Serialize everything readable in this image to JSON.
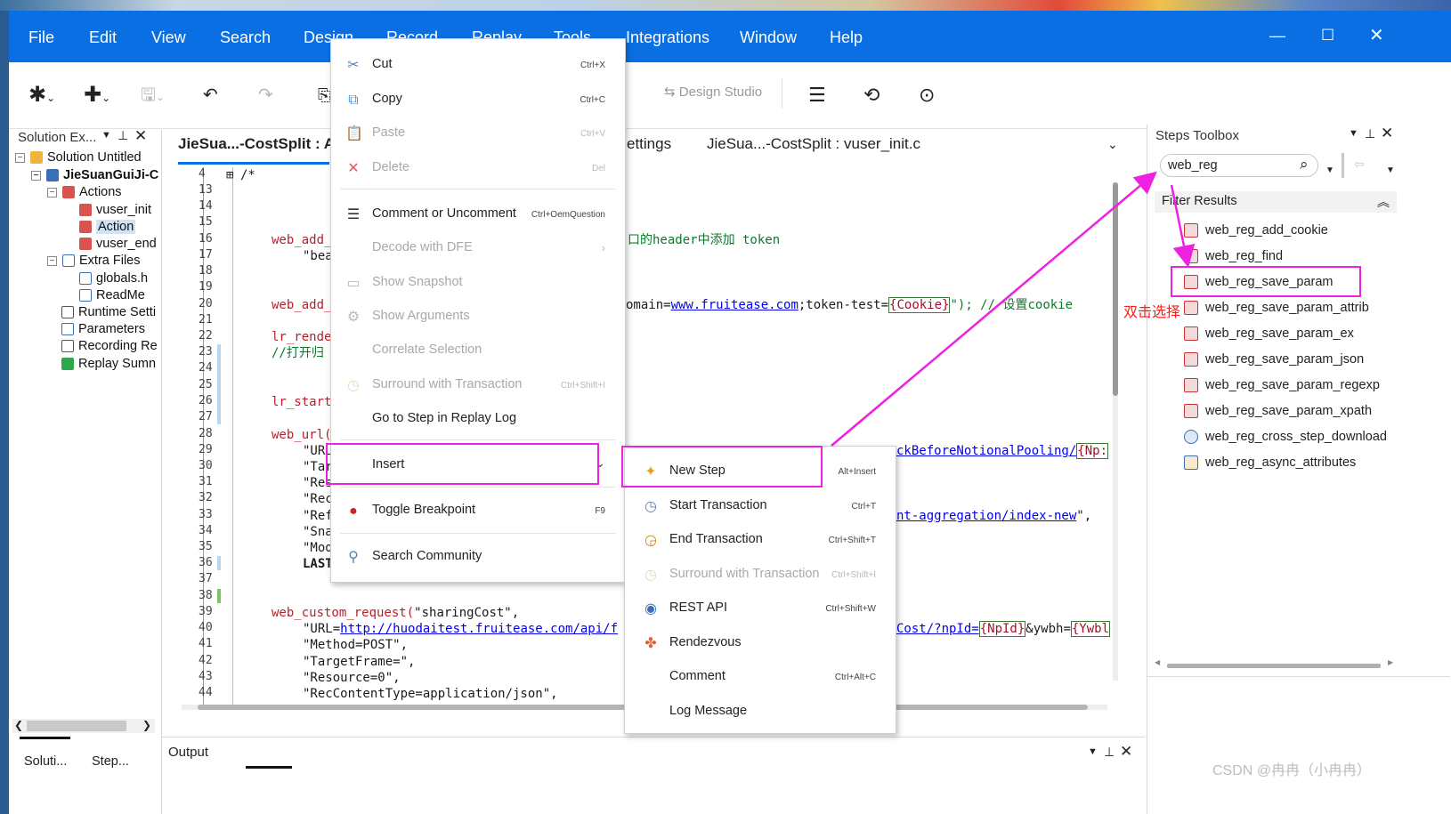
{
  "menubar": {
    "items": [
      "File",
      "Edit",
      "View",
      "Search",
      "Design",
      "Record",
      "Replay",
      "Tools",
      "Integrations",
      "Window",
      "Help"
    ],
    "color": "#0a6fe3"
  },
  "toolbar": {
    "design_studio": "Design Studio"
  },
  "solution_explorer": {
    "title": "Solution Ex...",
    "tree": [
      {
        "label": "Solution Untitled"
      },
      {
        "label": "JieSuanGuiJi-C"
      },
      {
        "label": "Actions"
      },
      {
        "label": "vuser_init"
      },
      {
        "label": "Action"
      },
      {
        "label": "vuser_end"
      },
      {
        "label": "Extra Files"
      },
      {
        "label": "globals.h"
      },
      {
        "label": "ReadMe"
      },
      {
        "label": "Runtime Setti"
      },
      {
        "label": "Parameters"
      },
      {
        "label": "Recording Re"
      },
      {
        "label": "Replay Sumn"
      }
    ],
    "bottom_tabs": [
      "Soluti...",
      "Step..."
    ]
  },
  "editor": {
    "tabs": [
      "JieSua...-CostSplit : A",
      "ettings",
      "JieSua...-CostSplit : vuser_init.c"
    ],
    "line_numbers": [
      "4",
      "13",
      "14",
      "15",
      "16",
      "17",
      "18",
      "19",
      "20",
      "21",
      "22",
      "23",
      "24",
      "25",
      "26",
      "27",
      "28",
      "29",
      "30",
      "31",
      "32",
      "33",
      "34",
      "35",
      "36",
      "37",
      "38",
      "39",
      "40",
      "41",
      "42",
      "43",
      "44"
    ],
    "code": {
      "l4": "/*",
      "l16_a": "web_add_",
      "l16_b": "口的header中添加 token",
      "l17": "\"bea",
      "l20_a": "web_add_",
      "l20_b": "omain=",
      "l20_link": "www.fruitease.com",
      "l20_c": ";token-test=",
      "l20_param": "{Cookie}",
      "l20_d": "\"); // 设置cookie",
      "l22": "lr_rende",
      "l23": "//打开归",
      "l26": "lr_start",
      "l28": "web_url(",
      "l29_a": "\"URL",
      "l29_link": "ckBeforeNotionalPooling/",
      "l29_param": "{Np:",
      "l30": "\"Tar",
      "l31": "\"Res",
      "l32": "\"Rec",
      "l33_a": "\"Ref",
      "l33_link": "nt-aggregation/index-new",
      "l33_b": "\",",
      "l34": "\"Sna",
      "l35": "\"Mod",
      "l36": "LAST",
      "l39_a": "web_custom_request(",
      "l39_b": "\"sharingCost\",",
      "l40_a": "\"URL=",
      "l40_link": "http://huodaitest.fruitease.com/api/f",
      "l40_link2": "Cost/?npId=",
      "l40_param": "{NpId}",
      "l40_b": "&ywbh=",
      "l40_param2": "{Ywbl",
      "l41": "\"Method=POST\",",
      "l42": "\"TargetFrame=\",",
      "l43": "\"Resource=0\",",
      "l44": "\"RecContentType=application/json\","
    }
  },
  "context_menu": {
    "items": [
      {
        "label": "Cut",
        "shortcut": "Ctrl+X",
        "icon": "scissors-icon",
        "disabled": false
      },
      {
        "label": "Copy",
        "shortcut": "Ctrl+C",
        "icon": "copy-icon",
        "disabled": false
      },
      {
        "label": "Paste",
        "shortcut": "Ctrl+V",
        "icon": "paste-icon",
        "disabled": true
      },
      {
        "label": "Delete",
        "shortcut": "Del",
        "icon": "delete-icon",
        "disabled": true
      },
      {
        "label": "Comment or Uncomment",
        "shortcut": "Ctrl+OemQuestion",
        "icon": "comment-icon",
        "disabled": false
      },
      {
        "label": "Decode with DFE",
        "shortcut": "",
        "icon": "",
        "disabled": true
      },
      {
        "label": "Show Snapshot",
        "shortcut": "",
        "icon": "snapshot-icon",
        "disabled": true
      },
      {
        "label": "Show Arguments",
        "shortcut": "",
        "icon": "arguments-icon",
        "disabled": true
      },
      {
        "label": "Correlate Selection",
        "shortcut": "",
        "icon": "",
        "disabled": true
      },
      {
        "label": "Surround with Transaction",
        "shortcut": "Ctrl+Shift+I",
        "icon": "transaction-icon",
        "disabled": true
      },
      {
        "label": "Go to Step in Replay Log",
        "shortcut": "",
        "icon": "",
        "disabled": false
      },
      {
        "label": "Insert",
        "shortcut": "",
        "icon": "",
        "disabled": false
      },
      {
        "label": "Toggle Breakpoint",
        "shortcut": "F9",
        "icon": "breakpoint-icon",
        "disabled": false
      },
      {
        "label": "Search Community",
        "shortcut": "",
        "icon": "community-icon",
        "disabled": false
      }
    ]
  },
  "insert_submenu": {
    "items": [
      {
        "label": "New Step",
        "shortcut": "Alt+Insert",
        "disabled": false
      },
      {
        "label": "Start Transaction",
        "shortcut": "Ctrl+T",
        "disabled": false
      },
      {
        "label": "End Transaction",
        "shortcut": "Ctrl+Shift+T",
        "disabled": false
      },
      {
        "label": "Surround with Transaction",
        "shortcut": "Ctrl+Shift+I",
        "disabled": true
      },
      {
        "label": "REST API",
        "shortcut": "Ctrl+Shift+W",
        "disabled": false
      },
      {
        "label": "Rendezvous",
        "shortcut": "",
        "disabled": false
      },
      {
        "label": "Comment",
        "shortcut": "Ctrl+Alt+C",
        "disabled": false
      },
      {
        "label": "Log Message",
        "shortcut": "",
        "disabled": false
      }
    ]
  },
  "steps_toolbox": {
    "title": "Steps Toolbox",
    "search_value": "web_reg",
    "filter_results_label": "Filter Results",
    "results": [
      "web_reg_add_cookie",
      "web_reg_find",
      "web_reg_save_param",
      "web_reg_save_param_attrib",
      "web_reg_save_param_ex",
      "web_reg_save_param_json",
      "web_reg_save_param_regexp",
      "web_reg_save_param_xpath",
      "web_reg_cross_step_download",
      "web_reg_async_attributes"
    ],
    "annotation": "双击选择"
  },
  "output": {
    "title": "Output"
  },
  "watermark": "CSDN @冉冉（小冉冉）",
  "highlight_color": "#ee21e0"
}
